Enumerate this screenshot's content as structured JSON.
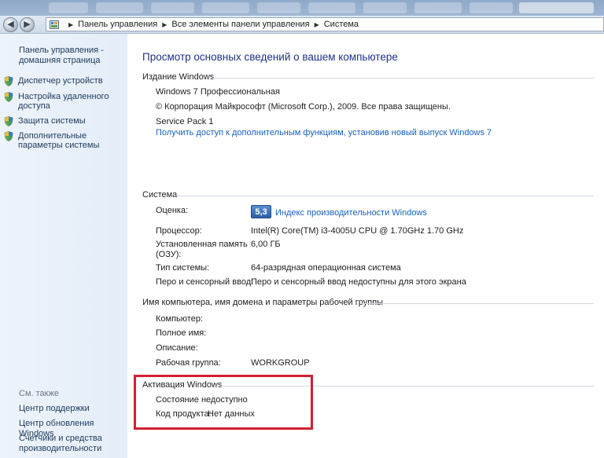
{
  "address": {
    "crumbs": [
      "Панель управления",
      "Все элементы панели управления",
      "Система"
    ]
  },
  "sidebar": {
    "home": "Панель управления - домашняя страница",
    "tasks": [
      {
        "label": "Диспетчер устройств",
        "icon": "shield-icon"
      },
      {
        "label": "Настройка удаленного доступа",
        "icon": "shield-icon"
      },
      {
        "label": "Защита системы",
        "icon": "shield-icon"
      },
      {
        "label": "Дополнительные параметры системы",
        "icon": "shield-icon"
      }
    ],
    "see_also_title": "См. также",
    "see_also": [
      "Центр поддержки",
      "Центр обновления Windows",
      "Счетчики и средства производительности"
    ]
  },
  "main": {
    "title": "Просмотр основных сведений о вашем компьютере",
    "edition": {
      "title": "Издание Windows",
      "name": "Windows 7 Профессиональная",
      "copyright": "© Корпорация Майкрософт (Microsoft Corp.), 2009. Все права защищены.",
      "service_pack": "Service Pack 1",
      "upgrade_link": "Получить доступ к дополнительным функциям, установив новый выпуск Windows 7"
    },
    "system": {
      "title": "Система",
      "rating_label": "Оценка:",
      "rating_score": "5,3",
      "rating_link": "Индекс производительности Windows",
      "processor_label": "Процессор:",
      "processor_value": "Intel(R) Core(TM) i3-4005U CPU @ 1.70GHz   1.70 GHz",
      "memory_label": "Установленная память (ОЗУ):",
      "memory_value": "6,00 ГБ",
      "type_label": "Тип системы:",
      "type_value": "64-разрядная операционная система",
      "pen_label": "Перо и сенсорный ввод:",
      "pen_value": "Перо и сенсорный ввод недоступны для этого экрана"
    },
    "computer": {
      "title": "Имя компьютера, имя домена и параметры рабочей группы",
      "computer_label": "Компьютер:",
      "fullname_label": "Полное имя:",
      "description_label": "Описание:",
      "workgroup_label": "Рабочая группа:",
      "workgroup_value": "WORKGROUP"
    },
    "activation": {
      "title": "Активация Windows",
      "status": "Состояние недоступно",
      "key_label": "Код продукта:",
      "key_value": "Нет данных"
    }
  },
  "colors": {
    "title_blue": "#1e3287",
    "link_blue": "#1560bd",
    "highlight_red": "#d2202f",
    "sidebar_bg": "#e9f0f9"
  }
}
